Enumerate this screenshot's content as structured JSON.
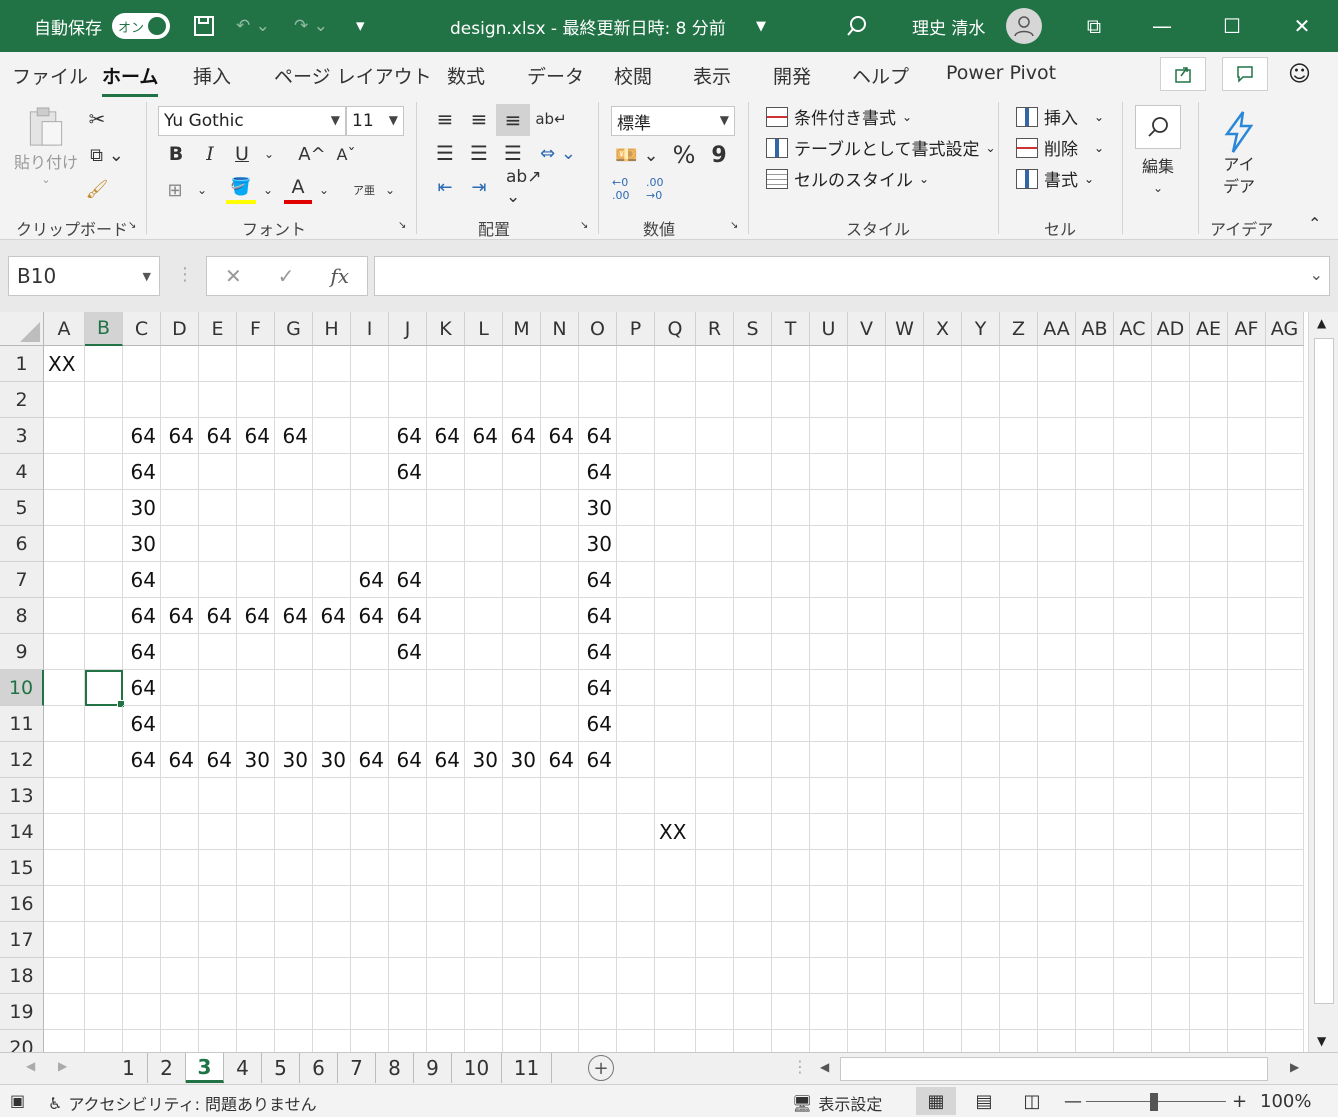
{
  "titlebar": {
    "autosave_label": "自動保存",
    "autosave_state": "オン",
    "document_title": "design.xlsx - 最終更新日時: 8 分前",
    "user_name": "理史 清水"
  },
  "ribbon_tabs": [
    "ファイル",
    "ホーム",
    "挿入",
    "ページ レイアウト",
    "数式",
    "データ",
    "校閲",
    "表示",
    "開発",
    "ヘルプ",
    "Power Pivot"
  ],
  "active_tab": "ホーム",
  "ribbon": {
    "clipboard": {
      "paste_label": "貼り付け",
      "group_label": "クリップボード"
    },
    "font": {
      "font_name": "Yu Gothic",
      "font_size": "11",
      "bold": "B",
      "italic": "I",
      "underline": "U",
      "grow": "A^",
      "shrink": "Aˇ",
      "font_color": "A",
      "phonetic": "ア亜",
      "group_label": "フォント"
    },
    "alignment": {
      "group_label": "配置"
    },
    "number": {
      "format": "標準",
      "percent": "%",
      "comma": "9",
      "inc_dec": "←0 .00",
      "dec_dec": ".00 →0",
      "group_label": "数値"
    },
    "styles": {
      "conditional": "条件付き書式",
      "as_table": "テーブルとして書式設定",
      "cell_styles": "セルのスタイル",
      "group_label": "スタイル"
    },
    "cells": {
      "insert": "挿入",
      "delete": "削除",
      "format": "書式",
      "group_label": "セル"
    },
    "editing": {
      "label": "編集"
    },
    "ideas": {
      "label_line1": "アイ",
      "label_line2": "デア",
      "group_label": "アイデア"
    }
  },
  "formula_bar": {
    "name_box": "B10",
    "cancel": "✕",
    "enter": "✓",
    "fx": "fx",
    "formula": ""
  },
  "sheet": {
    "columns": [
      "A",
      "B",
      "C",
      "D",
      "E",
      "F",
      "G",
      "H",
      "I",
      "J",
      "K",
      "L",
      "M",
      "N",
      "O",
      "P",
      "Q",
      "R",
      "S",
      "T",
      "U",
      "V",
      "W",
      "X",
      "Y",
      "Z",
      "AA",
      "AB",
      "AC",
      "AD",
      "AE",
      "AF",
      "AG"
    ],
    "rows": [
      "1",
      "2",
      "3",
      "4",
      "5",
      "6",
      "7",
      "8",
      "9",
      "10",
      "11",
      "12",
      "13",
      "14",
      "15",
      "16",
      "17",
      "18",
      "19",
      "20"
    ],
    "selected_cell": "B10",
    "cells": [
      {
        "ref": "A1",
        "v": "XX"
      },
      {
        "ref": "C3",
        "v": "64"
      },
      {
        "ref": "D3",
        "v": "64"
      },
      {
        "ref": "E3",
        "v": "64"
      },
      {
        "ref": "F3",
        "v": "64"
      },
      {
        "ref": "G3",
        "v": "64"
      },
      {
        "ref": "J3",
        "v": "64"
      },
      {
        "ref": "K3",
        "v": "64"
      },
      {
        "ref": "L3",
        "v": "64"
      },
      {
        "ref": "M3",
        "v": "64"
      },
      {
        "ref": "N3",
        "v": "64"
      },
      {
        "ref": "O3",
        "v": "64"
      },
      {
        "ref": "C4",
        "v": "64"
      },
      {
        "ref": "J4",
        "v": "64"
      },
      {
        "ref": "O4",
        "v": "64"
      },
      {
        "ref": "C5",
        "v": "30"
      },
      {
        "ref": "O5",
        "v": "30"
      },
      {
        "ref": "C6",
        "v": "30"
      },
      {
        "ref": "O6",
        "v": "30"
      },
      {
        "ref": "C7",
        "v": "64"
      },
      {
        "ref": "I7",
        "v": "64"
      },
      {
        "ref": "J7",
        "v": "64"
      },
      {
        "ref": "O7",
        "v": "64"
      },
      {
        "ref": "C8",
        "v": "64"
      },
      {
        "ref": "D8",
        "v": "64"
      },
      {
        "ref": "E8",
        "v": "64"
      },
      {
        "ref": "F8",
        "v": "64"
      },
      {
        "ref": "G8",
        "v": "64"
      },
      {
        "ref": "H8",
        "v": "64"
      },
      {
        "ref": "I8",
        "v": "64"
      },
      {
        "ref": "J8",
        "v": "64"
      },
      {
        "ref": "O8",
        "v": "64"
      },
      {
        "ref": "C9",
        "v": "64"
      },
      {
        "ref": "J9",
        "v": "64"
      },
      {
        "ref": "O9",
        "v": "64"
      },
      {
        "ref": "C10",
        "v": "64"
      },
      {
        "ref": "O10",
        "v": "64"
      },
      {
        "ref": "C11",
        "v": "64"
      },
      {
        "ref": "O11",
        "v": "64"
      },
      {
        "ref": "C12",
        "v": "64"
      },
      {
        "ref": "D12",
        "v": "64"
      },
      {
        "ref": "E12",
        "v": "64"
      },
      {
        "ref": "F12",
        "v": "30"
      },
      {
        "ref": "G12",
        "v": "30"
      },
      {
        "ref": "H12",
        "v": "30"
      },
      {
        "ref": "I12",
        "v": "64"
      },
      {
        "ref": "J12",
        "v": "64"
      },
      {
        "ref": "K12",
        "v": "64"
      },
      {
        "ref": "L12",
        "v": "30"
      },
      {
        "ref": "M12",
        "v": "30"
      },
      {
        "ref": "N12",
        "v": "64"
      },
      {
        "ref": "O12",
        "v": "64"
      },
      {
        "ref": "Q14",
        "v": "XX"
      }
    ]
  },
  "sheet_tabs": [
    "1",
    "2",
    "3",
    "4",
    "5",
    "6",
    "7",
    "8",
    "9",
    "10",
    "11"
  ],
  "active_sheet": "3",
  "status_bar": {
    "accessibility": "アクセシビリティ: 問題ありません",
    "display_settings": "表示設定",
    "zoom": "100%"
  }
}
